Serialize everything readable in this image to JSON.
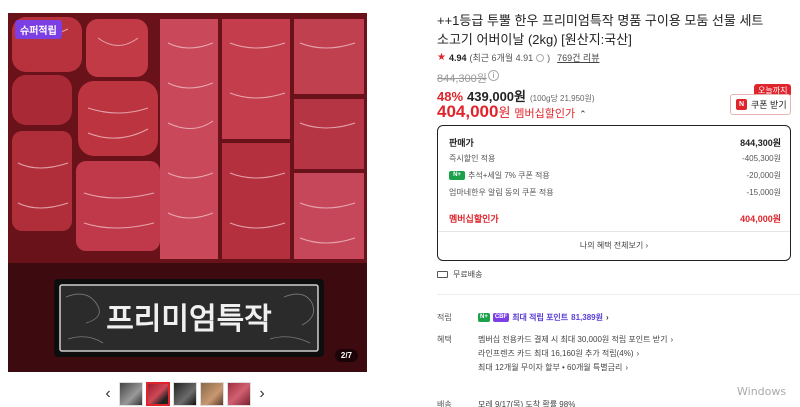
{
  "gallery": {
    "badge": "슈퍼적립",
    "counter": "2/7",
    "plaque_text": "프리미엄특작",
    "prev_arrow": "‹",
    "next_arrow": "›",
    "thumb_count": 5,
    "active_thumb": 2
  },
  "product": {
    "title": "++1등급 투뿔 한우 프리미엄특작 명품 구이용 모둠 선물 세트 소고기 어버이날 (2kg) [원산지:국산]",
    "rating": {
      "star": "★",
      "score": "4.94",
      "recent": "(최근 6개월 4.91",
      "recent_end": ")",
      "reviews": "769건 리뷰"
    },
    "original_price": "844,300원",
    "discount_percent": "48%",
    "sale_price": "439,000원",
    "unit_price": "(100g당 21,950원)",
    "member_price": "404,000",
    "member_price_suffix": "원",
    "member_label": "멤버십할인가",
    "member_caret": "⌃",
    "today_tag": "오늘까지",
    "coupon_label": "쿠폰 받기",
    "coupon_icon": "N"
  },
  "price_box": {
    "rows": [
      {
        "label": "판매가",
        "value": "844,300원"
      },
      {
        "label": "즉시할인 적용",
        "value": "-405,300원"
      },
      {
        "label": "추석+세일 7% 쿠폰 적용",
        "value": "-20,000원",
        "tag": "N+"
      },
      {
        "label": "엄마네한우 알림 동의 쿠폰 적용",
        "value": "-15,000원"
      },
      {
        "label": "멤버십할인가",
        "value": "404,000원"
      }
    ],
    "more_label": "나의 혜택 전체보기",
    "more_caret": "›"
  },
  "shipping": {
    "label": "무료배송"
  },
  "perks": {
    "points_label": "적립",
    "points_tag1": "N+",
    "points_tag2": "CBF",
    "points_text": "최대 적립 포인트",
    "points_value": "81,389원",
    "points_caret": "›",
    "benefits_label": "혜택",
    "benefits": [
      "멤버십 전용카드 결제 시 최대 30,000원 적립 포인트 받기",
      "라인프렌즈 카드 최대 16,160원 추가 적립(4%)",
      "최대 12개월 무이자 할부 • 60개월 특별금리"
    ],
    "benefit_caret": "›",
    "delivery_label": "배송",
    "delivery_text": "모레 9/17(목) 도착 확률 98%"
  },
  "watermark": "Windows",
  "colors": {
    "accent": "#e0242b",
    "naver_green": "#1aa14a",
    "points_purple": "#5a3fd6"
  },
  "icons": [
    "info-icon",
    "star-icon",
    "truck-icon",
    "coupon-n-icon",
    "chevron-right-icon",
    "chevron-left-icon"
  ]
}
